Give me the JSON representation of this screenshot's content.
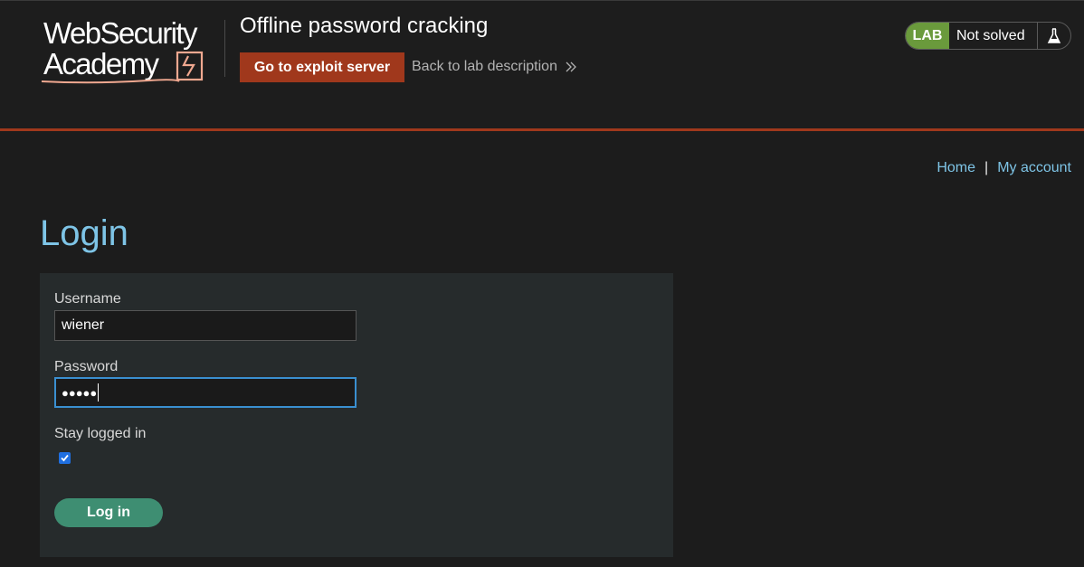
{
  "header": {
    "logo_line1": "WebSecurity",
    "logo_line2": "Academy",
    "lab_title": "Offline password cracking",
    "exploit_button": "Go to exploit server",
    "back_link": "Back to lab description",
    "lab_badge": "LAB",
    "lab_status": "Not solved",
    "accent_color": "#a0381c",
    "badge_color": "#6a9a3c"
  },
  "nav": {
    "home": "Home",
    "separator": "|",
    "account": "My account",
    "link_color": "#7ec4e6"
  },
  "login": {
    "title": "Login",
    "username_label": "Username",
    "username_value": "wiener",
    "password_label": "Password",
    "password_value": "●●●●●",
    "stay_logged_in_label": "Stay logged in",
    "stay_logged_in_checked": true,
    "submit_label": "Log in",
    "button_color": "#3e8e72"
  }
}
